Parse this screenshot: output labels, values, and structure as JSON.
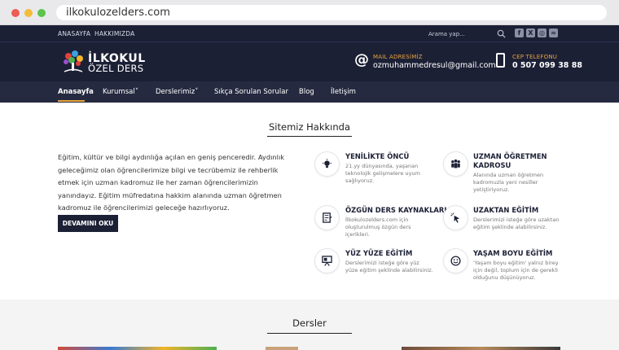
{
  "browser": {
    "url": "ilkokulozelders.com"
  },
  "topbar": {
    "links": [
      "ANASAYFA",
      "HAKKIMIZDA"
    ],
    "search_placeholder": "Arama yap...",
    "social": [
      {
        "icon": "facebook-icon",
        "glyph": "f"
      },
      {
        "icon": "twitter-x-icon",
        "glyph": "X"
      },
      {
        "icon": "instagram-icon",
        "glyph": "◎"
      },
      {
        "icon": "rss-icon",
        "glyph": "≈"
      }
    ]
  },
  "header": {
    "logo_line1": "İLKOKUL",
    "logo_line2": "ÖZEL DERS",
    "mail_label": "MAIL ADRESİMİZ",
    "mail_value": "ozmuhammedresul@gmail.com",
    "phone_label": "CEP TELEFONU",
    "phone_value": "0 507 099 38 88"
  },
  "nav": {
    "items": [
      "Anasayfa",
      "Kurumsal",
      "Derslerimiz",
      "Sıkça Sorulan Sorular",
      "Blog",
      "İletişim"
    ],
    "dropdown_glyph": "˅"
  },
  "about": {
    "title": "Sitemiz Hakkında",
    "text": "Eğitim, kültür ve bilgi aydınlığa açılan en geniş penceredir. Aydınlık geleceğimiz olan öğrencilerimize bilgi ve tecrübemiz ile rehberlik etmek için uzman kadromuz ile her zaman öğrencilerimizin yanındayız. Eğitim müfredatına hakkim alanında uzman öğretmen kadromuz ile öğrencilerimizi geleceğe hazırlıyoruz.",
    "button": "DEVAMINI OKU",
    "features": [
      {
        "icon": "lightbulb-icon",
        "title": "YENİLİKTE ÖNCÜ",
        "desc": "21.yy dünyasında, yaşanan teknolojik gelişmelere uyum sağlıyoruz."
      },
      {
        "icon": "team-icon",
        "title": "UZMAN ÖĞRETMEN KADROSU",
        "desc": "Alanında uzman öğretmen kadromuzla yeni nesiller yetiştiriyoruz."
      },
      {
        "icon": "notebook-icon",
        "title": "ÖZGÜN DERS KAYNAKLARI",
        "desc": "İlkokulozelders.com için oluşturulmuş özgün ders içerikleri."
      },
      {
        "icon": "cursor-click-icon",
        "title": "UZAKTAN EĞİTİM",
        "desc": "Derslerimizi isteğe göre uzaktan eğitim şeklinde alabilirsiniz."
      },
      {
        "icon": "presentation-icon",
        "title": "YÜZ YÜZE EĞİTİM",
        "desc": "Derslerimizi isteğe göre yüz yüze eğitim şeklinde alabilirsiniz."
      },
      {
        "icon": "smile-icon",
        "title": "YAŞAM BOYU EĞİTİM",
        "desc": "'Yaşam boyu eğitim' yalnız birey için değil, toplum için de gerekli olduğunu düşünüyoruz."
      }
    ]
  },
  "courses": {
    "title": "Dersler"
  }
}
